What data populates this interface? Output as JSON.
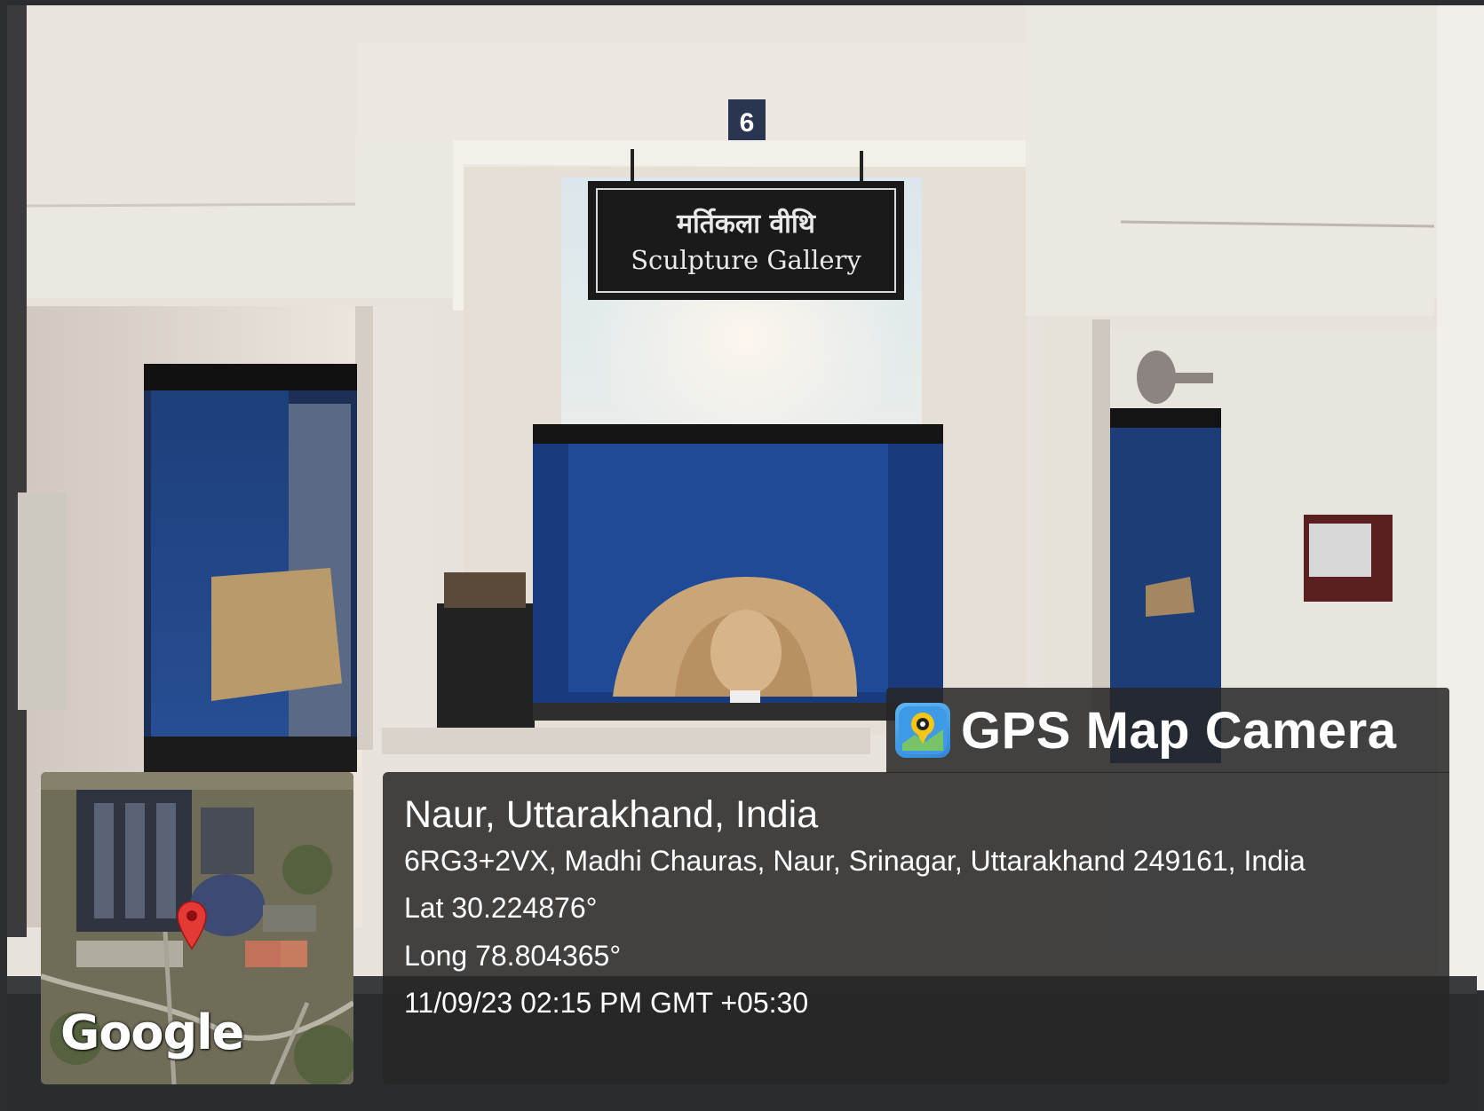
{
  "photo": {
    "room_number": "6",
    "sign": {
      "hindi": "मर्तिकला वीथि",
      "english": "Sculpture Gallery"
    }
  },
  "gps_stamp": {
    "app_name": "GPS Map Camera",
    "location_title": "Naur, Uttarakhand, India",
    "address": "6RG3+2VX, Madhi Chauras, Naur, Srinagar, Uttarakhand 249161, India",
    "latitude": "Lat 30.224876°",
    "longitude": "Long 78.804365°",
    "datetime": "11/09/23 02:15 PM GMT +05:30",
    "map_attribution": "Google",
    "icons": [
      "gps-map-camera-app-icon",
      "map-pin-icon"
    ]
  }
}
